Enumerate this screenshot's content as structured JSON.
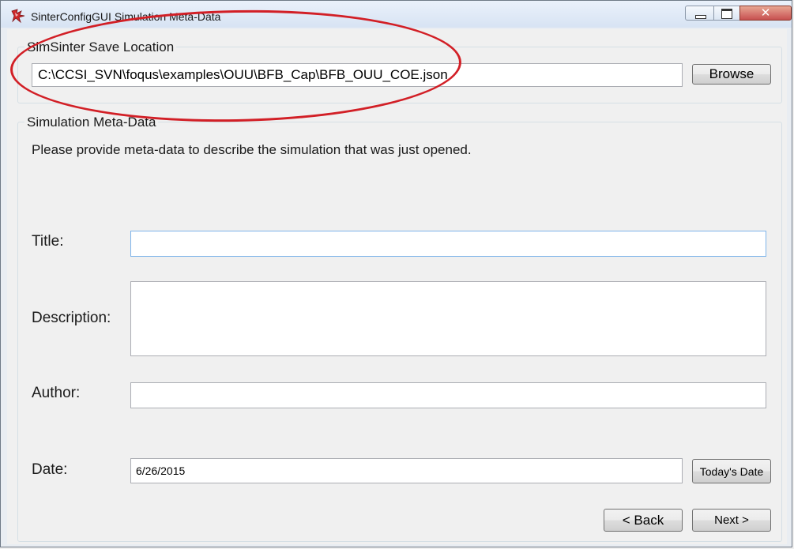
{
  "window": {
    "title": "SinterConfigGUI Simulation Meta-Data",
    "annotation_color": "#d21f26"
  },
  "save_location": {
    "group_label": "SimSinter Save Location",
    "path_value": "C:\\CCSI_SVN\\foqus\\examples\\OUU\\BFB_Cap\\BFB_OUU_COE.json",
    "browse_label": "Browse"
  },
  "metadata": {
    "group_label": "Simulation Meta-Data",
    "instructions": "Please provide meta-data to describe the simulation that was just opened.",
    "title_label": "Title:",
    "title_value": "",
    "description_label": "Description:",
    "description_value": "",
    "author_label": "Author:",
    "author_value": "",
    "date_label": "Date:",
    "date_value": "6/26/2015",
    "todays_date_label": "Today's Date"
  },
  "nav": {
    "back_label": "< Back",
    "next_label": "Next >"
  }
}
